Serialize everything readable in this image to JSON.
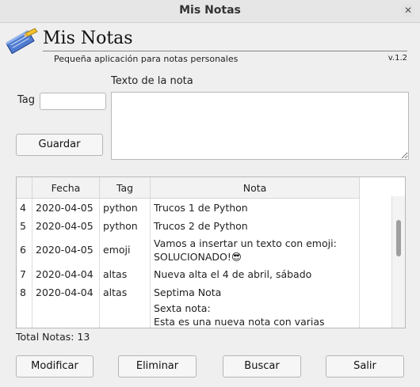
{
  "window": {
    "title": "Mis Notas"
  },
  "header": {
    "app_title": "Mis Notas",
    "subtitle": "Pequeña aplicación para notas personales",
    "version": "v.1.2"
  },
  "form": {
    "note_label": "Texto de la nota",
    "tag_label": "Tag",
    "tag_value": "",
    "note_value": "",
    "save_button": "Guardar"
  },
  "table": {
    "columns": [
      "",
      "Fecha",
      "Tag",
      "Nota"
    ],
    "rows": [
      {
        "id": "4",
        "fecha": "2020-04-05",
        "tag": "python",
        "nota": "Trucos 1 de Python"
      },
      {
        "id": "5",
        "fecha": "2020-04-05",
        "tag": "python",
        "nota": "Trucos 2 de Python"
      },
      {
        "id": "6",
        "fecha": "2020-04-05",
        "tag": "emoji",
        "nota": "Vamos a insertar un texto con emoji:\nSOLUCIONADO!😎"
      },
      {
        "id": "7",
        "fecha": "2020-04-04",
        "tag": "altas",
        "nota": "Nueva alta el 4 de abril, sábado"
      },
      {
        "id": "8",
        "fecha": "2020-04-04",
        "tag": "altas",
        "nota": "Septima Nota"
      },
      {
        "id": "",
        "fecha": "",
        "tag": "",
        "nota": "Sexta nota:\nEsta es una nueva nota con varias lineas."
      }
    ]
  },
  "footer": {
    "total": "Total Notas: 13",
    "buttons": {
      "modify": "Modificar",
      "delete": "Eliminar",
      "search": "Buscar",
      "exit": "Salir"
    }
  },
  "colors": {
    "window_bg": "#efefef",
    "titlebar_bg": "#e6e6e6"
  },
  "icons": {
    "logo": "notebook-pencil-icon",
    "close": "close-icon"
  }
}
